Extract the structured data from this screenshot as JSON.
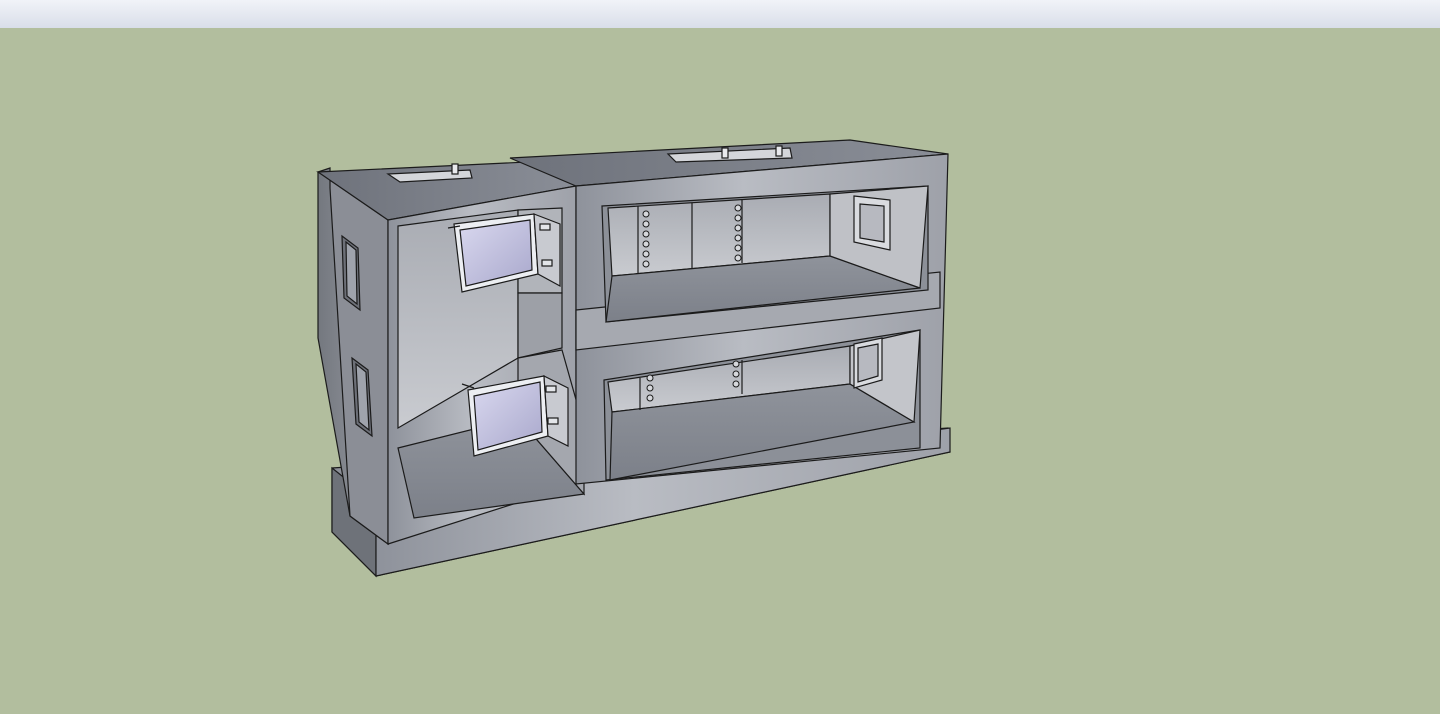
{
  "app": {
    "toolbar_colors": {
      "top": "#f1f3f8",
      "bottom": "#d9dee9"
    }
  },
  "viewport": {
    "background": "#b2be9e",
    "model_color": "#9a9da6"
  }
}
